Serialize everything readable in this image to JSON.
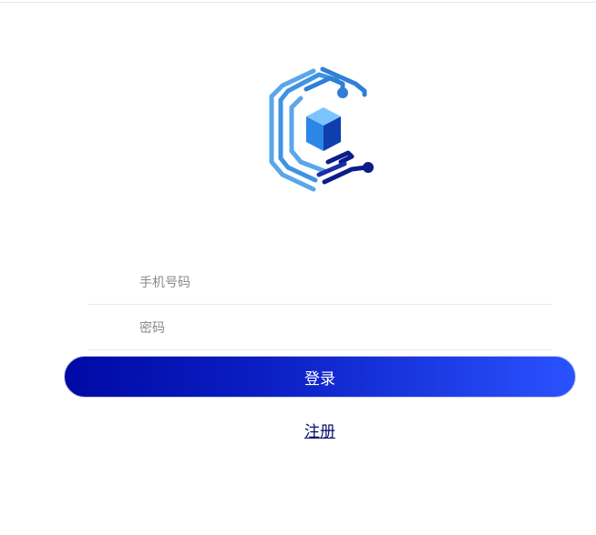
{
  "login_form": {
    "phone_placeholder": "手机号码",
    "phone_value": "",
    "password_placeholder": "密码",
    "password_value": "",
    "login_label": "登录",
    "register_label": "注册"
  },
  "brand": {
    "logo_icon": "circuit-c-cube-icon"
  },
  "colors": {
    "button_gradient_start": "#0009a5",
    "button_gradient_end": "#2a52ff",
    "logo_light_blue": "#5aa6ea",
    "logo_mid_blue": "#2f7fd8",
    "logo_dark_navy": "#0c1d8a",
    "cube_top": "#7cc4ff",
    "cube_left": "#2b86e6",
    "cube_right": "#0f3fae"
  }
}
